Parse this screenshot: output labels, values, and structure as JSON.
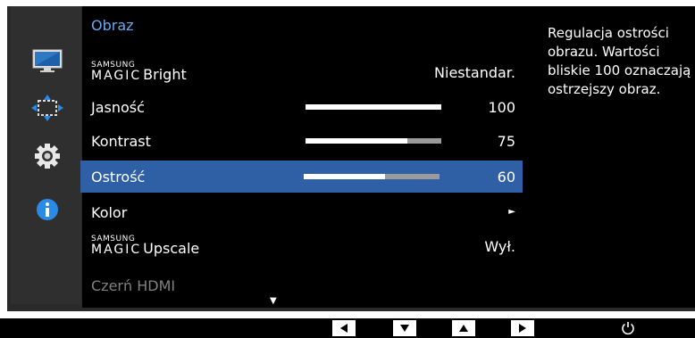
{
  "menu": {
    "title": "Obraz",
    "items": [
      {
        "brand_small": "SAMSUNG",
        "brand_big": "MAGIC",
        "label": "Bright",
        "value": "Niestandar."
      },
      {
        "label": "Jasność",
        "value": "100",
        "level": 100
      },
      {
        "label": "Kontrast",
        "value": "75",
        "level": 75
      },
      {
        "label": "Ostrość",
        "value": "60",
        "level": 60
      },
      {
        "label": "Kolor",
        "value": "►"
      },
      {
        "brand_small": "SAMSUNG",
        "brand_big": "MAGIC",
        "label": "Upscale",
        "value": "Wył."
      },
      {
        "label": "Czerń HDMI"
      }
    ],
    "scroll_arrow": "▼"
  },
  "sidebar": {
    "icons": [
      "monitor-icon",
      "move-arrows-icon",
      "gear-icon",
      "info-icon"
    ]
  },
  "help": {
    "text": "Regulacja ostrości obrazu. Wartości bliskie 100 oznaczają ostrzejszy obraz."
  },
  "colors": {
    "accent": "#2f5fa5",
    "title": "#6aa8f0",
    "bar_track": "#9b9b9b"
  }
}
